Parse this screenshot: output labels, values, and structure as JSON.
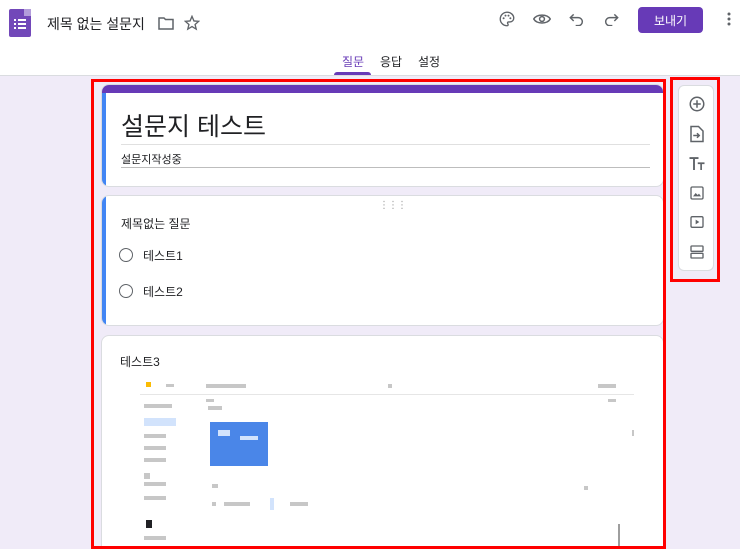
{
  "header": {
    "doc_title": "제목 없는 설문지",
    "send_label": "보내기",
    "accent": "#673ab7"
  },
  "tabs": [
    {
      "label": "질문",
      "active": true
    },
    {
      "label": "응답",
      "active": false
    },
    {
      "label": "설정",
      "active": false
    }
  ],
  "form": {
    "title": "설문지 테스트",
    "description": "설문지작성중"
  },
  "question": {
    "title": "제목없는 질문",
    "options": [
      "테스트1",
      "테스트2"
    ]
  },
  "image_item": {
    "title": "테스트3"
  },
  "toolbar_icons": [
    "add-question-icon",
    "import-questions-icon",
    "add-title-icon",
    "add-image-icon",
    "add-video-icon",
    "add-section-icon"
  ],
  "highlight_color": "#ff0000"
}
